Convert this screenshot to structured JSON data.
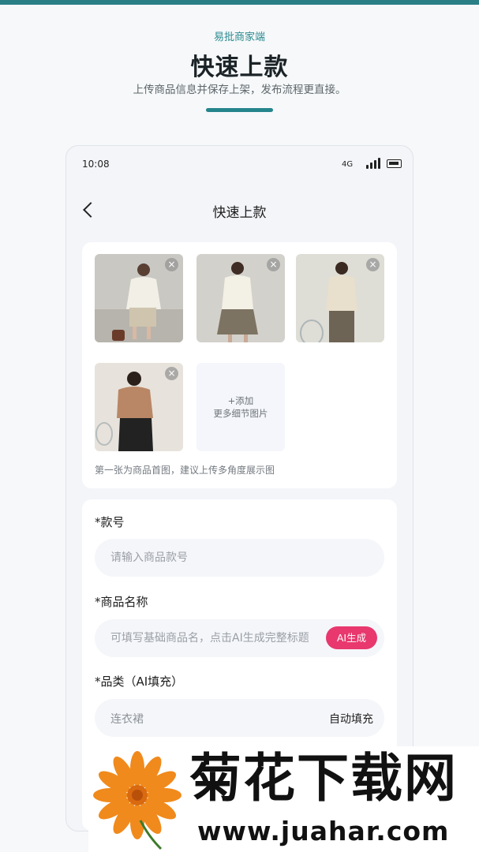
{
  "header": {
    "brand": "易批商家端",
    "title": "快速上款",
    "subtitle": "上传商品信息并保存上架，发布流程更直接。",
    "accent_color": "#26858c"
  },
  "status_bar": {
    "time": "10:08",
    "network": "4G",
    "icons": [
      "signal-icon",
      "battery-icon"
    ]
  },
  "nav": {
    "title": "快速上款",
    "back_icon": "chevron-left-icon"
  },
  "photos": {
    "items": [
      {
        "name": "photo-1",
        "delete_label": "×"
      },
      {
        "name": "photo-2",
        "delete_label": "×"
      },
      {
        "name": "photo-3",
        "delete_label": "×"
      },
      {
        "name": "photo-4",
        "delete_label": "×"
      }
    ],
    "add_tile": {
      "line1": "+添加",
      "line2": "更多细节图片"
    },
    "hint": "第一张为商品首图，建议上传多角度展示图"
  },
  "form": {
    "style_no": {
      "label": "*款号",
      "placeholder": "请输入商品款号"
    },
    "product_name": {
      "label": "*商品名称",
      "placeholder": "可填写基础商品名，点击AI生成完整标题",
      "ai_button": "AI生成",
      "ai_color": "#e8386e"
    },
    "category": {
      "label": "*品类（AI填充）",
      "value": "连衣裙",
      "action": "自动填充"
    }
  },
  "watermark": {
    "title": "菊花下载网",
    "url": "www.juahar.com"
  }
}
